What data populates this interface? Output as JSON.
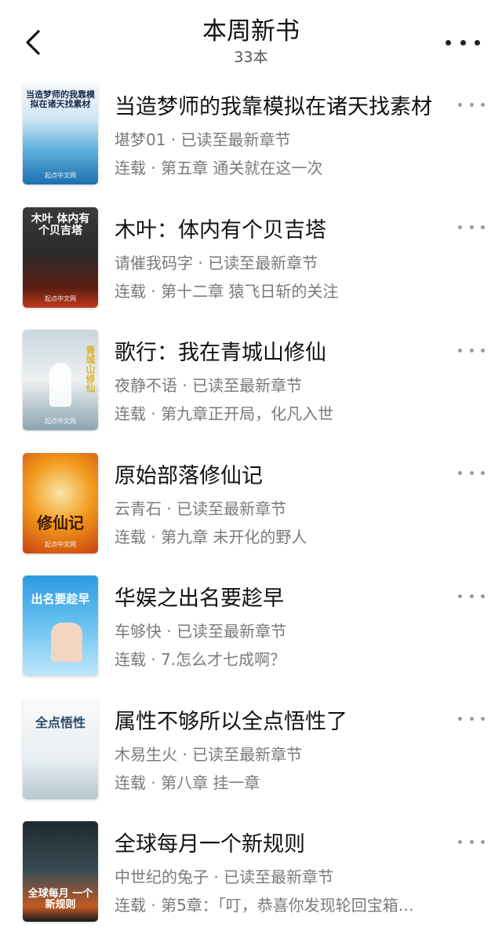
{
  "header": {
    "title": "本周新书",
    "count": "33本"
  },
  "books": [
    {
      "title": "当造梦师的我靠模拟在诸天找素材",
      "meta": "堪梦01 · 已读至最新章节",
      "chapter": "连载 · 第五章 通关就在这一次",
      "cover_text": "当造梦师的我靠模拟在诸天找素材",
      "cover_pub": "起点中文网"
    },
    {
      "title": "木叶：体内有个贝吉塔",
      "meta": "请催我码字 · 已读至最新章节",
      "chapter": "连载 · 第十二章 猿飞日斩的关注",
      "cover_text": "木叶 体内有个贝吉塔",
      "cover_pub": "起点中文网"
    },
    {
      "title": "歌行：我在青城山修仙",
      "meta": "夜静不语 · 已读至最新章节",
      "chapter": "连载 · 第九章正开局，化凡入世",
      "cover_text": "青城山修仙",
      "cover_pub": "起点中文网"
    },
    {
      "title": "原始部落修仙记",
      "meta": "云青石 · 已读至最新章节",
      "chapter": "连载 · 第九章 未开化的野人",
      "cover_text": "修仙记",
      "cover_pub": "起点中文网"
    },
    {
      "title": "华娱之出名要趁早",
      "meta": "车够快 · 已读至最新章节",
      "chapter": "连载 · 7.怎么才七成啊？",
      "cover_text": "出名要趁早",
      "cover_pub": ""
    },
    {
      "title": "属性不够所以全点悟性了",
      "meta": "木易生火 · 已读至最新章节",
      "chapter": "连载 · 第八章 挂一章",
      "cover_text": "全点悟性",
      "cover_pub": ""
    },
    {
      "title": "全球每月一个新规则",
      "meta": "中世纪的兔子 · 已读至最新章节",
      "chapter": "连载 · 第5章：「叮，恭喜你发现轮回宝箱…",
      "cover_text": "全球每月 一个新规则",
      "cover_pub": ""
    }
  ]
}
